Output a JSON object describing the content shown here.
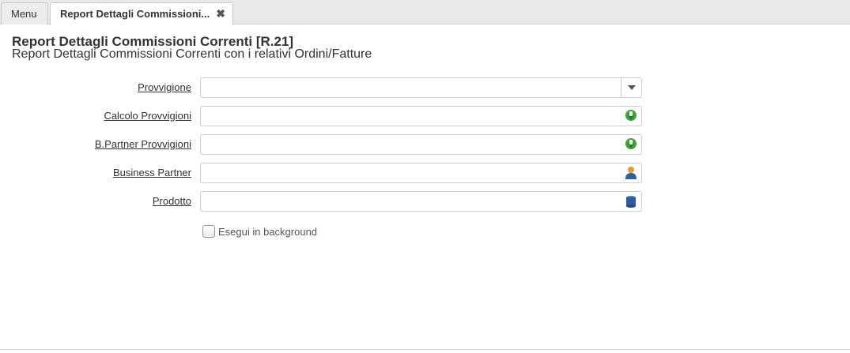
{
  "tabs": {
    "menu_label": "Menu",
    "report_label": "Report Dettagli Commissioni...",
    "close_glyph": "✖"
  },
  "header": {
    "title": "Report Dettagli Commissioni Correnti [R.21]",
    "subtitle": "Report Dettagli Commissioni Correnti con i relativi Ordini/Fatture"
  },
  "fields": [
    {
      "label": "Provvigione",
      "value": "",
      "icon": "dropdown-icon"
    },
    {
      "label": "Calcolo Provvigioni",
      "value": "",
      "icon": "green-arrow-icon"
    },
    {
      "label": "B.Partner Provvigioni",
      "value": "",
      "icon": "green-arrow-icon"
    },
    {
      "label": "Business Partner",
      "value": "",
      "icon": "person-icon"
    },
    {
      "label": "Prodotto",
      "value": "",
      "icon": "product-icon"
    }
  ],
  "background_option": {
    "label": "Esegui in background",
    "checked": false
  },
  "colors": {
    "accent_green": "#3fa33a",
    "person_orange": "#e99a2c",
    "person_blue": "#2c5f9e",
    "product_blue": "#2d5d9f"
  }
}
